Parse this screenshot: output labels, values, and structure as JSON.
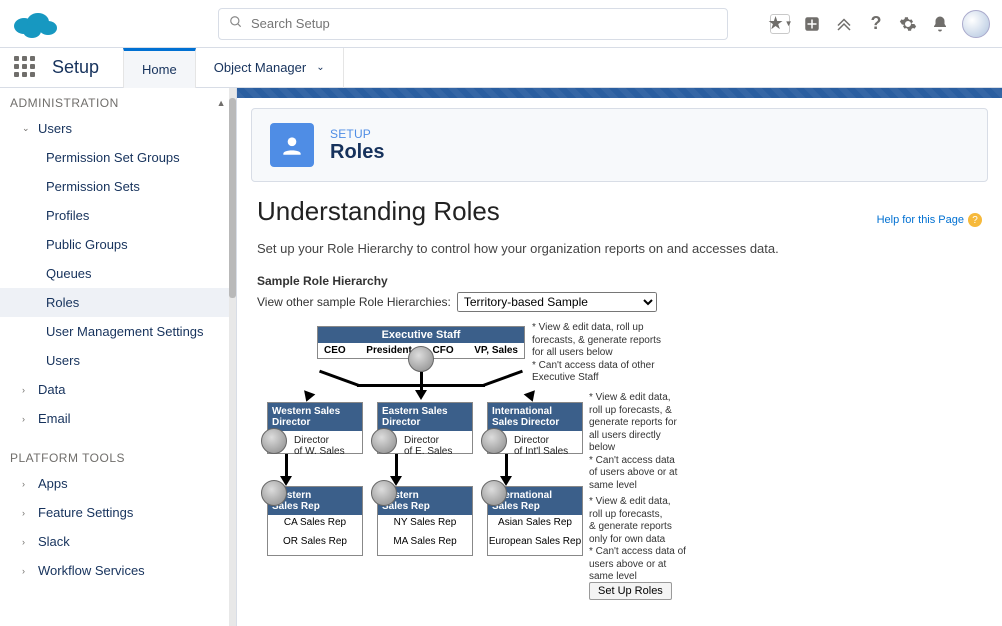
{
  "search": {
    "placeholder": "Search Setup"
  },
  "app": {
    "name": "Setup"
  },
  "tabs": {
    "home": "Home",
    "object_manager": "Object Manager"
  },
  "sidebar": {
    "section1": "ADMINISTRATION",
    "users": "Users",
    "items": [
      "Permission Set Groups",
      "Permission Sets",
      "Profiles",
      "Public Groups",
      "Queues",
      "Roles",
      "User Management Settings",
      "Users"
    ],
    "data": "Data",
    "email": "Email",
    "section2": "PLATFORM TOOLS",
    "apps": "Apps",
    "feature": "Feature Settings",
    "slack": "Slack",
    "workflow": "Workflow Services"
  },
  "page": {
    "eyebrow": "SETUP",
    "title": "Roles",
    "heading": "Understanding Roles",
    "help": "Help for this Page",
    "intro": "Set up your Role Hierarchy to control how your organization reports on and accesses data.",
    "sample_label": "Sample Role Hierarchy",
    "dropdown_label": "View other sample Role Hierarchies:",
    "dropdown_value": "Territory-based Sample",
    "setup_btn": "Set Up Roles"
  },
  "hier": {
    "top": {
      "title": "Executive Staff",
      "roles": [
        "CEO",
        "President",
        "CFO",
        "VP, Sales"
      ]
    },
    "note_top": [
      "* View & edit data, roll up",
      "forecasts, & generate reports",
      "for all users below",
      "* Can't access data of other",
      "Executive Staff"
    ],
    "mid": [
      {
        "title1": "Western Sales",
        "title2": "Director",
        "sub1": "Director",
        "sub2": "of W. Sales"
      },
      {
        "title1": "Eastern Sales",
        "title2": "Director",
        "sub1": "Director",
        "sub2": "of E. Sales"
      },
      {
        "title1": "International",
        "title2": "Sales Director",
        "sub1": "Director",
        "sub2": "of Int'l Sales"
      }
    ],
    "note_mid": [
      "* View & edit data,",
      "roll up forecasts, &",
      "generate reports for",
      "all users directly",
      "below",
      "* Can't access data",
      "of users above or at",
      "same level"
    ],
    "bot": [
      {
        "title1": "Western",
        "title2": "Sales Rep",
        "r1": "CA Sales Rep",
        "r2": "OR Sales Rep"
      },
      {
        "title1": "Eastern",
        "title2": "Sales Rep",
        "r1": "NY Sales Rep",
        "r2": "MA Sales Rep"
      },
      {
        "title1": "International",
        "title2": "Sales Rep",
        "r1": "Asian Sales Rep",
        "r2": "European Sales Rep"
      }
    ],
    "note_bot": [
      "* View & edit data,",
      "roll up forecasts,",
      "& generate reports",
      "only for own data",
      "* Can't access data of",
      "users above or at",
      "same level"
    ]
  }
}
